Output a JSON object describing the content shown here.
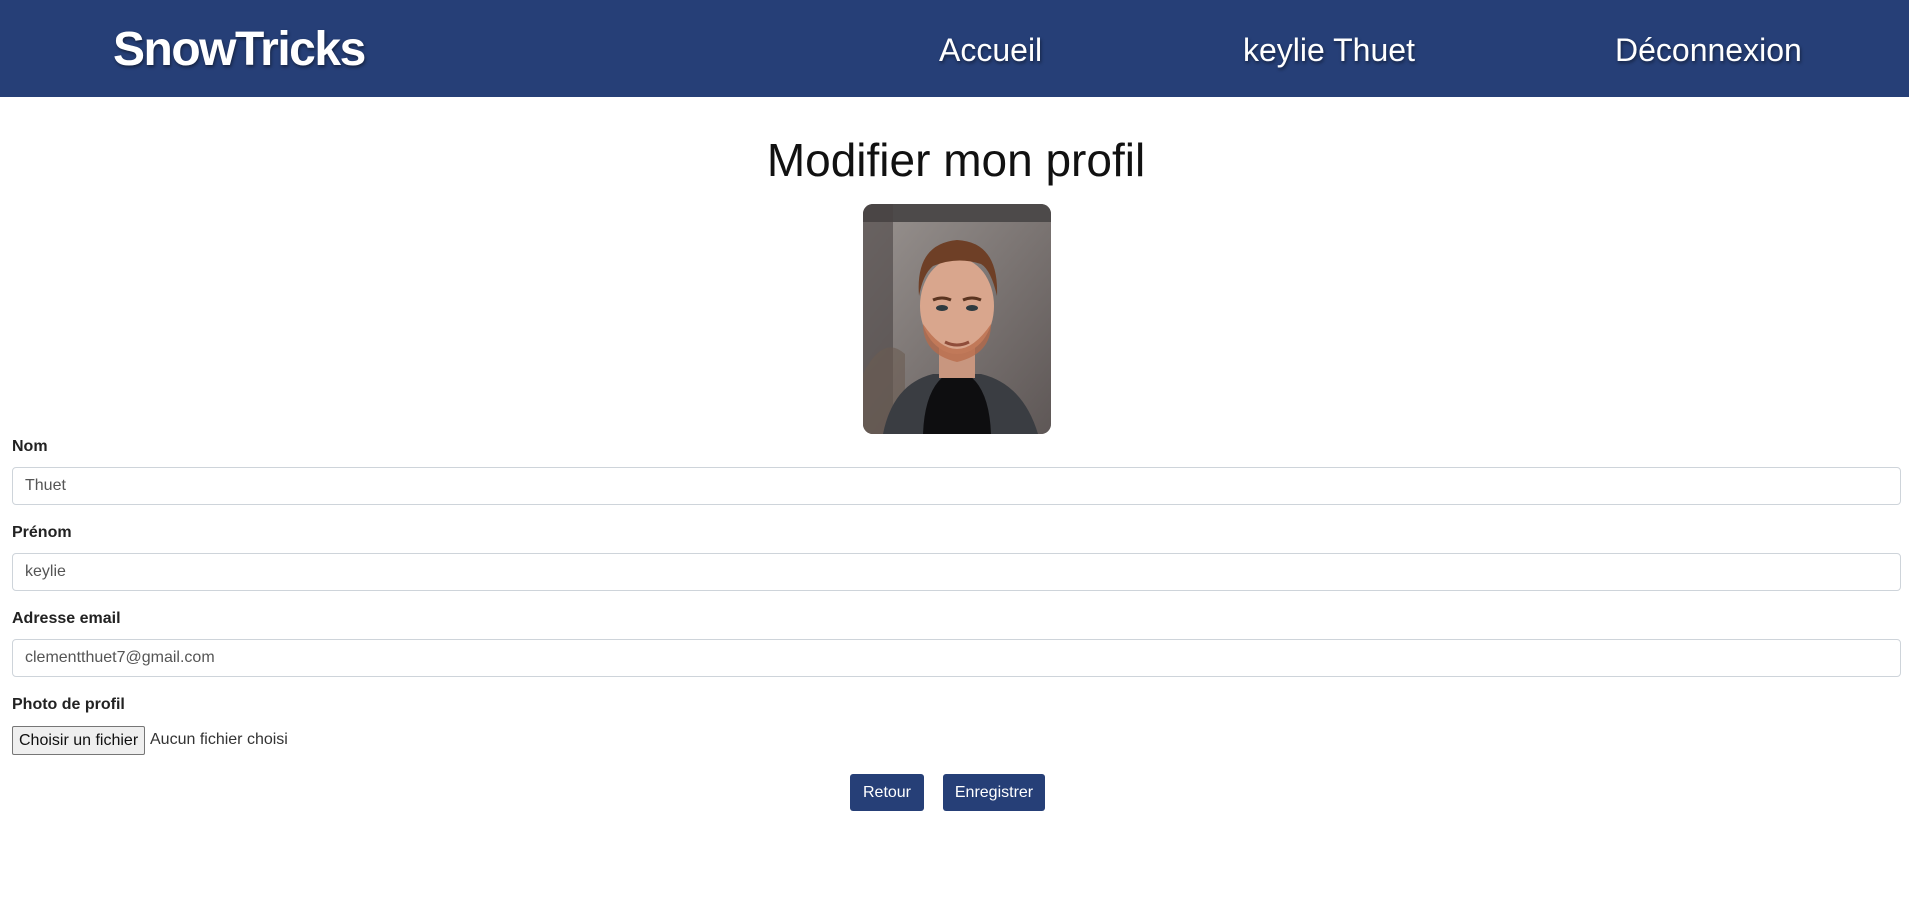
{
  "navbar": {
    "brand": "SnowTricks",
    "links": [
      "Accueil",
      "keylie Thuet",
      "Déconnexion"
    ],
    "background_color": "#263f77"
  },
  "page": {
    "title": "Modifier mon profil",
    "avatar_icon": "profile-photo"
  },
  "form": {
    "nom": {
      "label": "Nom",
      "value": "Thuet"
    },
    "prenom": {
      "label": "Prénom",
      "value": "keylie"
    },
    "email": {
      "label": "Adresse email",
      "value": "clementthuet7@gmail.com"
    },
    "photo": {
      "label": "Photo de profil",
      "button_label": "Choisir un fichier",
      "status": "Aucun fichier choisi"
    }
  },
  "actions": {
    "back_label": "Retour",
    "save_label": "Enregistrer",
    "button_color": "#263f77"
  }
}
